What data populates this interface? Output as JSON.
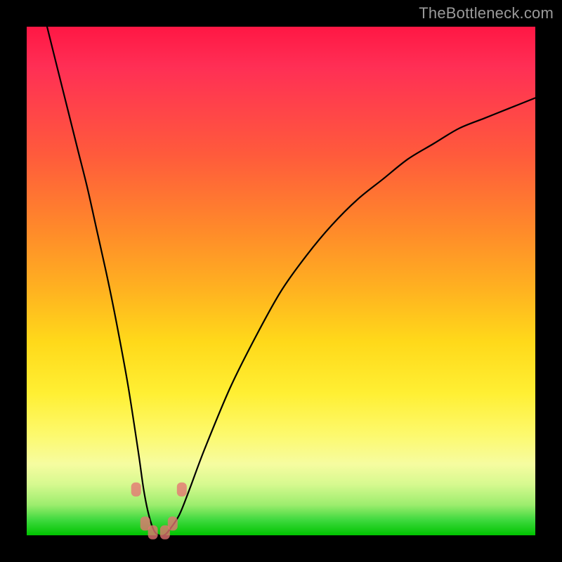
{
  "watermark": "TheBottleneck.com",
  "chart_data": {
    "type": "line",
    "title": "",
    "xlabel": "",
    "ylabel": "",
    "xlim": [
      0,
      100
    ],
    "ylim": [
      0,
      100
    ],
    "grid": false,
    "legend": false,
    "series": [
      {
        "name": "bottleneck-curve",
        "x": [
          4,
          6,
          8,
          10,
          12,
          14,
          16,
          18,
          20,
          22,
          23,
          24,
          25,
          26,
          27,
          28,
          30,
          32,
          35,
          40,
          45,
          50,
          55,
          60,
          65,
          70,
          75,
          80,
          85,
          90,
          95,
          100
        ],
        "values": [
          100,
          92,
          84,
          76,
          68,
          59,
          50,
          40,
          29,
          16,
          9,
          4,
          1,
          0,
          0,
          1,
          4,
          9,
          17,
          29,
          39,
          48,
          55,
          61,
          66,
          70,
          74,
          77,
          80,
          82,
          84,
          86
        ]
      }
    ],
    "markers": [
      {
        "x": 21.5,
        "y": 9.0
      },
      {
        "x": 23.3,
        "y": 2.3
      },
      {
        "x": 24.8,
        "y": 0.6
      },
      {
        "x": 27.2,
        "y": 0.6
      },
      {
        "x": 28.7,
        "y": 2.3
      },
      {
        "x": 30.5,
        "y": 9.0
      }
    ],
    "background": {
      "type": "vertical-gradient",
      "stops": [
        {
          "pos": 0,
          "color": "#ff1744"
        },
        {
          "pos": 25,
          "color": "#ff5a3c"
        },
        {
          "pos": 52,
          "color": "#ffb320"
        },
        {
          "pos": 72,
          "color": "#ffef33"
        },
        {
          "pos": 90,
          "color": "#d6f98f"
        },
        {
          "pos": 100,
          "color": "#00c400"
        }
      ]
    }
  }
}
